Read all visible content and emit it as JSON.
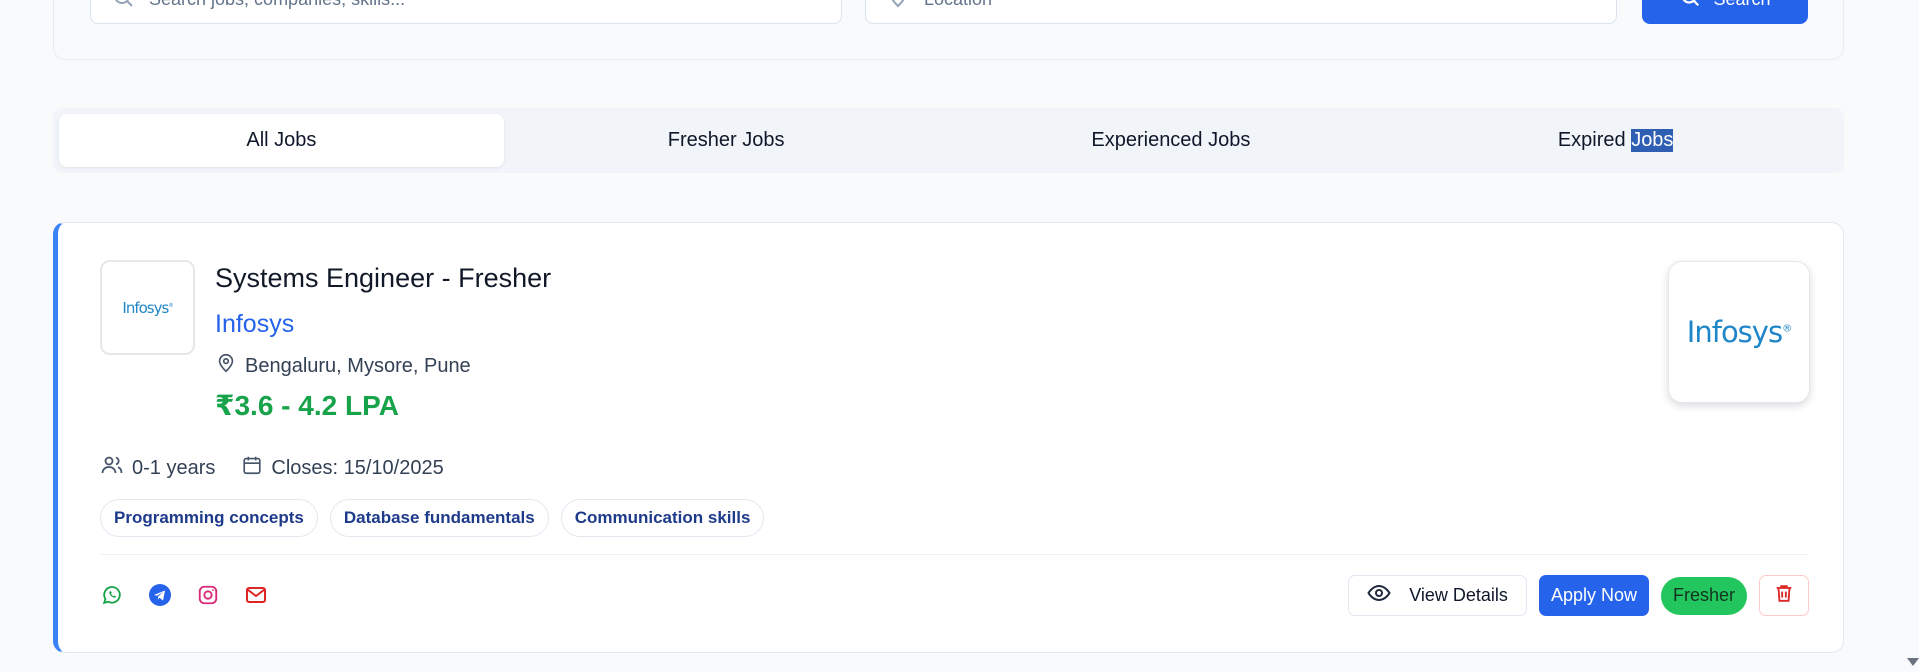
{
  "search": {
    "keyword_placeholder": "Search jobs, companies, skills...",
    "location_placeholder": "Location",
    "button_label": "Search"
  },
  "tabs": [
    {
      "label": "All Jobs",
      "active": true
    },
    {
      "label": "Fresher Jobs",
      "active": false
    },
    {
      "label": "Experienced Jobs",
      "active": false
    },
    {
      "label_prefix": "Expired ",
      "label_selected": "Jobs",
      "active": false
    }
  ],
  "job": {
    "title": "Systems Engineer - Fresher",
    "company": "Infosys",
    "logo_text": "Infosys",
    "logo_mark": "®",
    "location": "Bengaluru, Mysore, Pune",
    "salary": "₹3.6 - 4.2 LPA",
    "experience": "0-1 years",
    "closes": "Closes: 15/10/2025",
    "skills": [
      "Programming concepts",
      "Database fundamentals",
      "Communication skills"
    ],
    "view_details_label": "View Details",
    "apply_label": "Apply Now",
    "type_badge": "Fresher"
  },
  "share_icons": [
    "whatsapp-icon",
    "telegram-icon",
    "instagram-icon",
    "mail-icon"
  ],
  "colors": {
    "primary": "#2563eb",
    "accent_border": "#3b82f6",
    "salary_green": "#16a34a",
    "badge_green": "#22c55e",
    "delete_red": "#dc2626"
  }
}
